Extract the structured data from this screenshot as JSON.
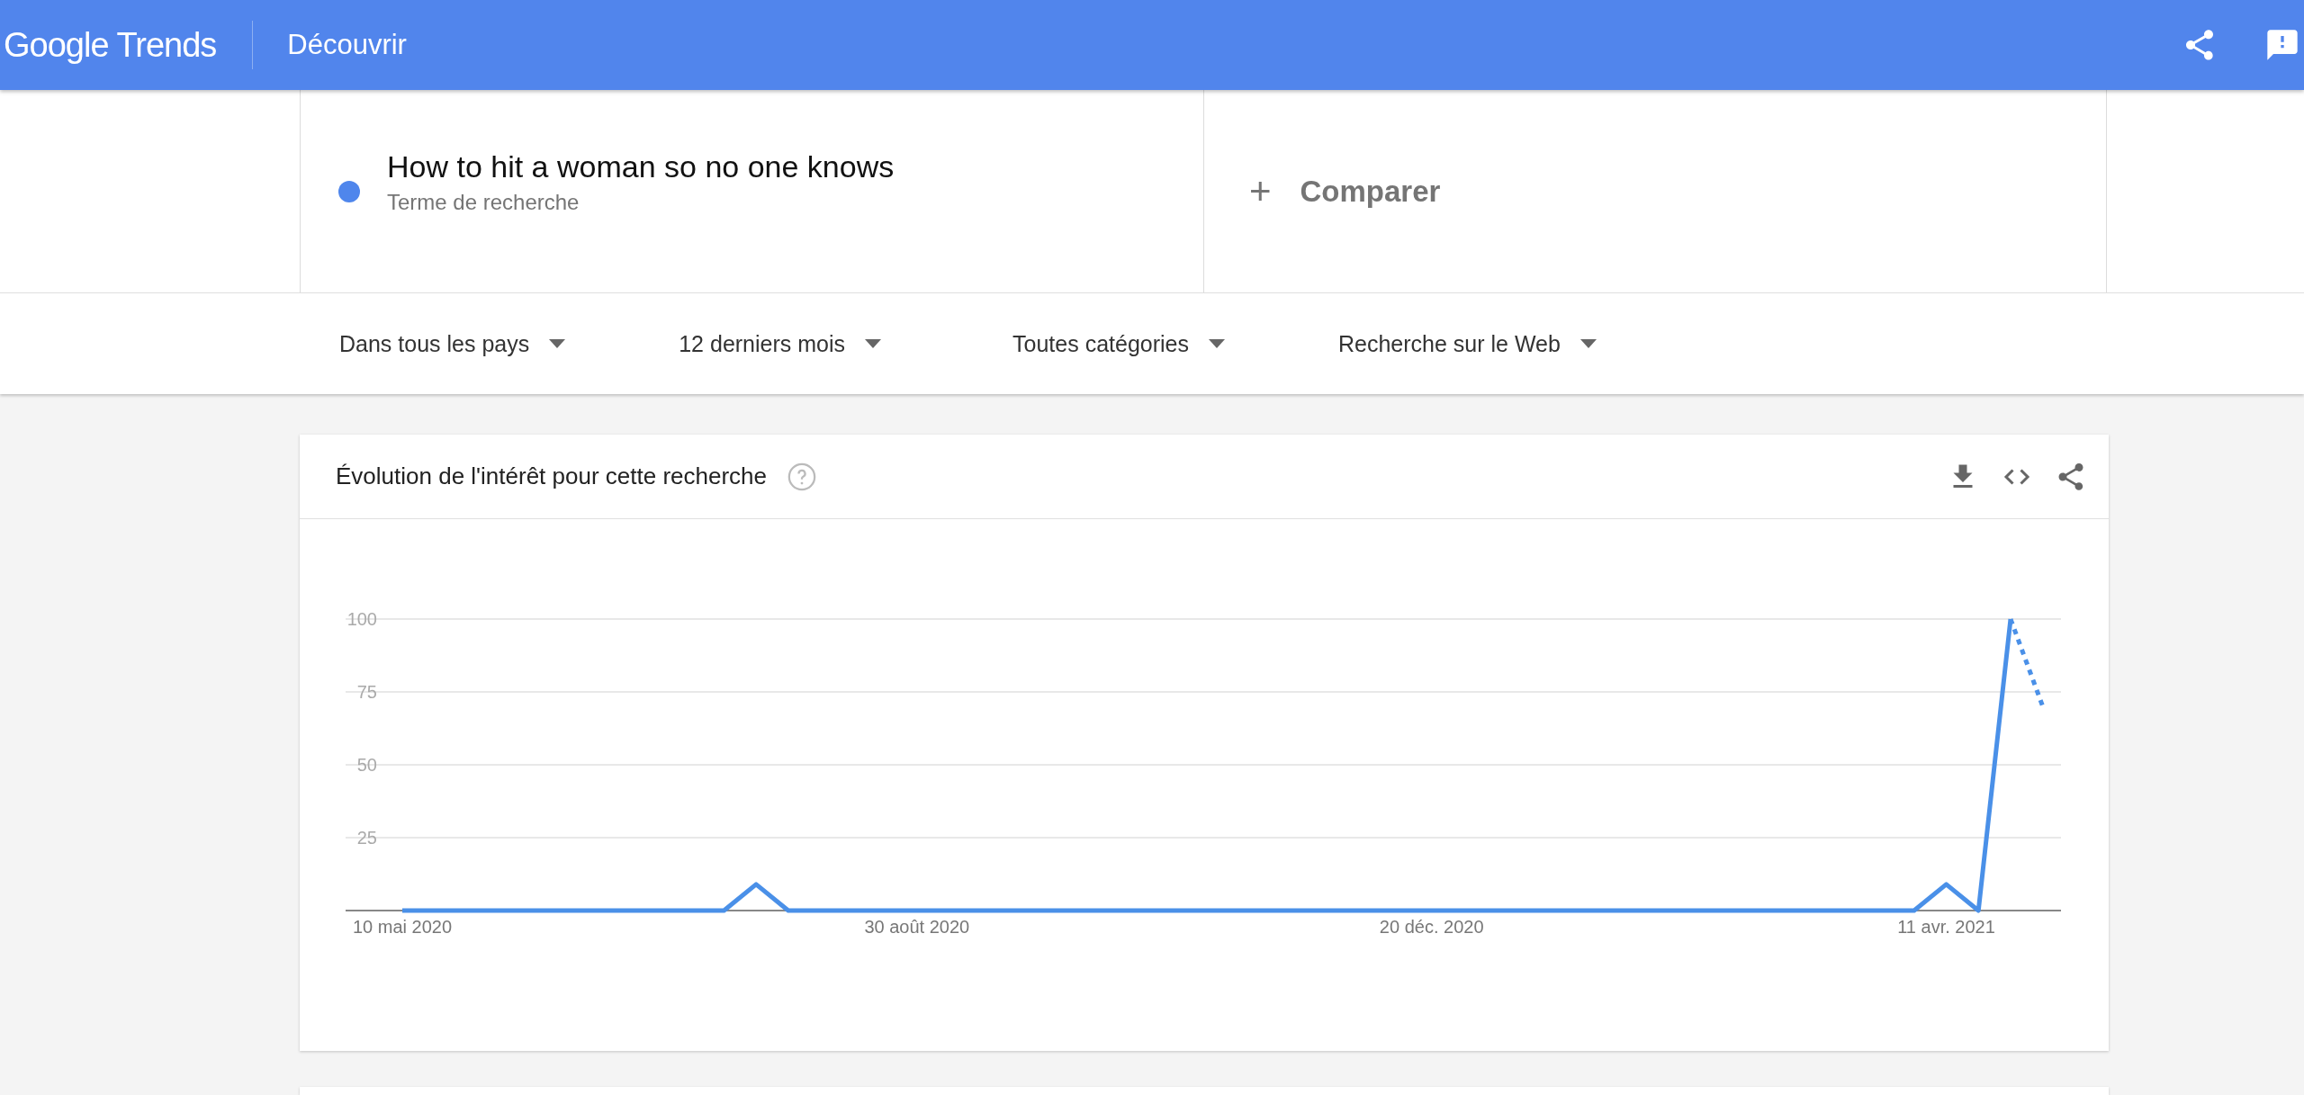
{
  "header": {
    "logo": [
      "Google",
      "Trends"
    ],
    "section": "Découvrir"
  },
  "terms": [
    {
      "kind": "term",
      "label": "How to hit a woman so no one knows",
      "sublabel": "Terme de recherche",
      "color": "#4f86ec"
    },
    {
      "kind": "compare",
      "symbol": "+",
      "label": "Comparer"
    }
  ],
  "filters": [
    "Dans tous les pays",
    "12 derniers mois",
    "Toutes catégories",
    "Recherche sur le Web"
  ],
  "card": {
    "title": "Évolution de l'intérêt pour cette recherche",
    "chart_data": {
      "type": "line",
      "categories": [
        "10 mai 2020",
        null,
        null,
        null,
        null,
        null,
        null,
        null,
        null,
        null,
        null,
        null,
        null,
        null,
        null,
        null,
        "30 août 2020",
        null,
        null,
        null,
        null,
        null,
        null,
        null,
        null,
        null,
        null,
        null,
        null,
        null,
        null,
        null,
        "20 déc. 2020",
        null,
        null,
        null,
        null,
        null,
        null,
        null,
        null,
        null,
        null,
        null,
        null,
        null,
        null,
        null,
        "11 avr. 2021",
        null,
        null,
        null
      ],
      "ylim": [
        0,
        100
      ],
      "yticks": [
        25,
        50,
        75,
        100
      ],
      "grid": true,
      "series": [
        {
          "color": "#4a90e8",
          "line_style": "solid",
          "values": [
            0,
            0,
            0,
            0,
            0,
            0,
            0,
            0,
            0,
            0,
            0,
            9,
            0,
            0,
            0,
            0,
            0,
            0,
            0,
            0,
            0,
            0,
            0,
            0,
            0,
            0,
            0,
            0,
            0,
            0,
            0,
            0,
            0,
            0,
            0,
            0,
            0,
            0,
            0,
            0,
            0,
            0,
            0,
            0,
            0,
            0,
            0,
            0,
            9,
            0,
            100,
            null
          ]
        },
        {
          "color": "#4a90e8",
          "line_style": "dashed",
          "values": [
            null,
            null,
            null,
            null,
            null,
            null,
            null,
            null,
            null,
            null,
            null,
            null,
            null,
            null,
            null,
            null,
            null,
            null,
            null,
            null,
            null,
            null,
            null,
            null,
            null,
            null,
            null,
            null,
            null,
            null,
            null,
            null,
            null,
            null,
            null,
            null,
            null,
            null,
            null,
            null,
            null,
            null,
            null,
            null,
            null,
            null,
            null,
            null,
            null,
            null,
            100,
            70
          ]
        }
      ]
    }
  }
}
